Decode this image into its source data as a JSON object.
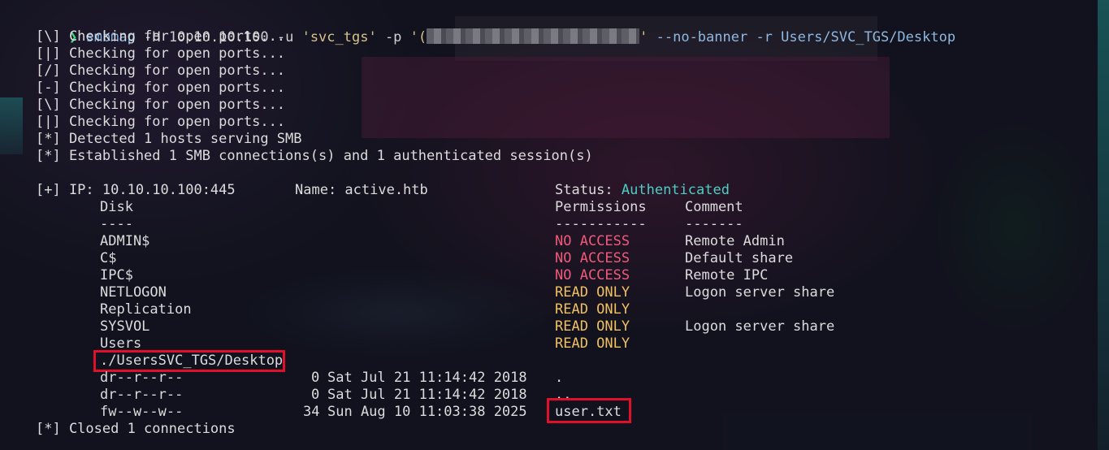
{
  "prompt_symbol": "❯",
  "command": {
    "program": "smbmap",
    "args_1": " -H 10.10.10.100 -u ",
    "user": "'svc_tgs'",
    "args_2": " -p ",
    "pass_open": "'(",
    "pass_close": "'",
    "args_3": " --no-banner -r Users/SVC_TGS/Desktop"
  },
  "progress_lines": [
    "[\\] Checking for open ports...",
    "[|] Checking for open ports...",
    "[/] Checking for open ports...",
    "[-] Checking for open ports...",
    "[\\] Checking for open ports...",
    "[|] Checking for open ports..."
  ],
  "detected": "[*] Detected 1 hosts serving SMB",
  "established": "[*] Established 1 SMB connections(s) and 1 authenticated session(s)",
  "host": {
    "ip_label": "[+] IP: 10.10.10.100:445",
    "name_label": "Name: active.htb",
    "status_label": "Status: ",
    "status_value": "Authenticated"
  },
  "share_headers": {
    "disk": "Disk",
    "disk_rule": "----",
    "permissions": "Permissions",
    "permissions_rule": "-----------",
    "comment": "Comment",
    "comment_rule": "-------"
  },
  "shares": [
    {
      "name": "ADMIN$",
      "perm": "NO ACCESS",
      "perm_color": "#f05a7a",
      "comment": "Remote Admin"
    },
    {
      "name": "C$",
      "perm": "NO ACCESS",
      "perm_color": "#f05a7a",
      "comment": "Default share"
    },
    {
      "name": "IPC$",
      "perm": "NO ACCESS",
      "perm_color": "#f05a7a",
      "comment": "Remote IPC"
    },
    {
      "name": "NETLOGON",
      "perm": "READ ONLY",
      "perm_color": "#f0c060",
      "comment": "Logon server share"
    },
    {
      "name": "Replication",
      "perm": "READ ONLY",
      "perm_color": "#f0c060",
      "comment": ""
    },
    {
      "name": "SYSVOL",
      "perm": "READ ONLY",
      "perm_color": "#f0c060",
      "comment": "Logon server share"
    },
    {
      "name": "Users",
      "perm": "READ ONLY",
      "perm_color": "#f0c060",
      "comment": ""
    }
  ],
  "dir_path": "./UsersSVC_TGS/Desktop",
  "entries": [
    {
      "mode": "dr--r--r--",
      "size": "0",
      "date": "Sat Jul 21 11:14:42 2018",
      "name": "."
    },
    {
      "mode": "dr--r--r--",
      "size": "0",
      "date": "Sat Jul 21 11:14:42 2018",
      "name": ".."
    },
    {
      "mode": "fw--w--w--",
      "size": "34",
      "date": "Sun Aug 10 11:03:38 2025",
      "name": "user.txt"
    }
  ],
  "closed": "[*] Closed 1 connections",
  "colors": {
    "highlight_box": "#e0102a",
    "prompt": "#3ddc84",
    "authenticated": "#4ecdc4",
    "no_access": "#f05a7a",
    "read_only": "#f0c060"
  }
}
